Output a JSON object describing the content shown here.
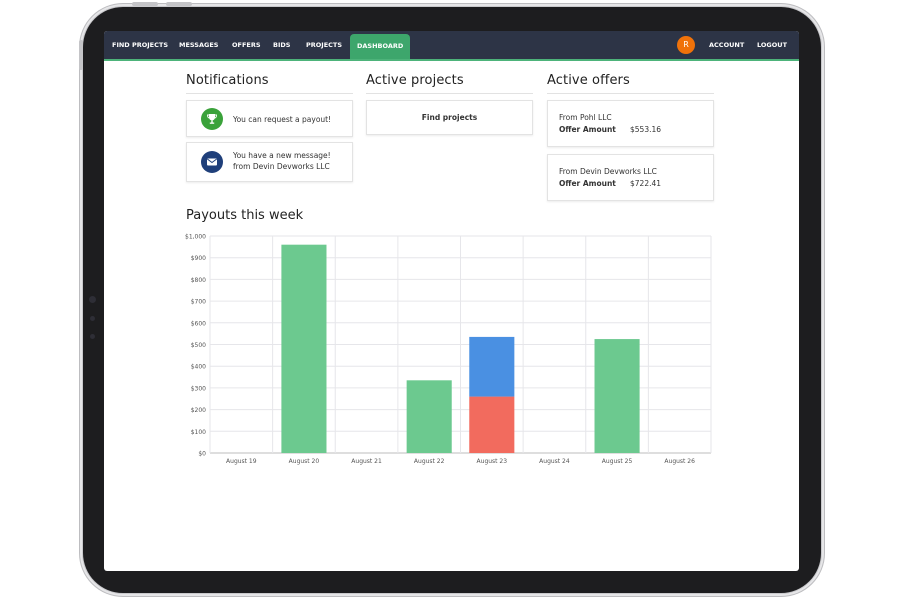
{
  "nav": {
    "items": [
      "FIND PROJECTS",
      "MESSAGES",
      "OFFERS",
      "BIDS",
      "PROJECTS",
      "DASHBOARD"
    ],
    "active": "DASHBOARD",
    "avatar_initial": "R",
    "account": "ACCOUNT",
    "logout": "LOGOUT"
  },
  "notifications": {
    "title": "Notifications",
    "items": [
      {
        "icon": "trophy-icon",
        "color": "#3aa23a",
        "text": "You can request a payout!"
      },
      {
        "icon": "envelope-icon",
        "color": "#1f3f7a",
        "line1": "You have a new message!",
        "line2": "from Devin Devworks LLC"
      }
    ]
  },
  "active_projects": {
    "title": "Active projects",
    "find_label": "Find projects"
  },
  "active_offers": {
    "title": "Active offers",
    "offers": [
      {
        "from": "From Pohl LLC",
        "amount_label": "Offer Amount",
        "amount": "$553.16"
      },
      {
        "from": "From Devin Devworks LLC",
        "amount_label": "Offer Amount",
        "amount": "$722.41"
      }
    ]
  },
  "payouts_title": "Payouts this week",
  "colors": {
    "green": "#6cc98f",
    "blue": "#4a90e2",
    "red": "#f26b5e",
    "nav_bg": "#2d3446",
    "accent": "#3da66c"
  },
  "chart_data": {
    "type": "bar",
    "stacked": true,
    "categories": [
      "August 19",
      "August 20",
      "August 21",
      "August 22",
      "August 23",
      "August 24",
      "August 25",
      "August 26"
    ],
    "series": [
      {
        "color": "#6cc98f",
        "values": [
          0,
          960,
          0,
          335,
          0,
          0,
          525,
          0
        ]
      },
      {
        "color": "#f26b5e",
        "values": [
          0,
          0,
          0,
          0,
          260,
          0,
          0,
          0
        ]
      },
      {
        "color": "#4a90e2",
        "values": [
          0,
          0,
          0,
          0,
          275,
          0,
          0,
          0
        ]
      }
    ],
    "ylim": [
      0,
      1000
    ],
    "yticks": [
      "$0",
      "$100",
      "$200",
      "$300",
      "$400",
      "$500",
      "$600",
      "$700",
      "$800",
      "$900",
      "$1,000"
    ],
    "grid": true
  }
}
